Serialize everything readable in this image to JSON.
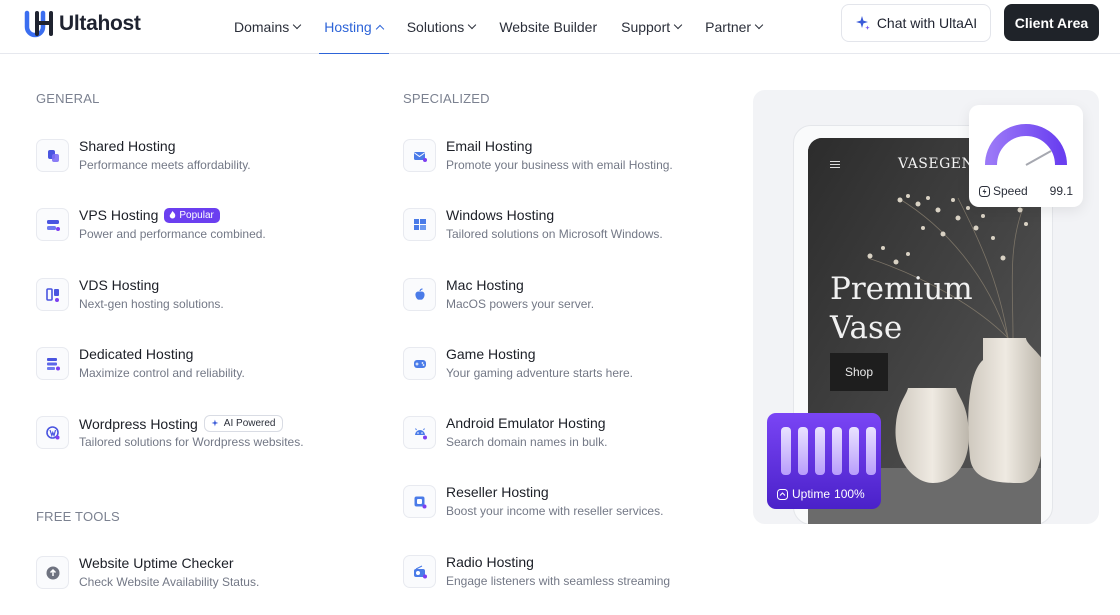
{
  "brand": {
    "logo_text": "Ultahost",
    "accent_color": "#2d64d8",
    "purple": "#6b3ff0"
  },
  "nav": {
    "items": [
      {
        "label": "Domains",
        "dropdown": true,
        "active": false
      },
      {
        "label": "Hosting",
        "dropdown": true,
        "active": true
      },
      {
        "label": "Solutions",
        "dropdown": true,
        "active": false
      },
      {
        "label": "Website Builder",
        "dropdown": false,
        "active": false
      },
      {
        "label": "Support",
        "dropdown": true,
        "active": false
      },
      {
        "label": "Partner",
        "dropdown": true,
        "active": false
      }
    ],
    "chat_label": "Chat with UltaAI",
    "client_area_label": "Client Area"
  },
  "general": {
    "title": "GENERAL",
    "items": [
      {
        "title": "Shared Hosting",
        "desc": "Performance meets affordability.",
        "icon": "shared-hosting-icon"
      },
      {
        "title": "VPS Hosting",
        "desc": "Power and performance combined.",
        "badge": "Popular",
        "icon": "vps-hosting-icon"
      },
      {
        "title": "VDS Hosting",
        "desc": "Next-gen hosting solutions.",
        "icon": "vds-hosting-icon"
      },
      {
        "title": "Dedicated Hosting",
        "desc": "Maximize control and reliability.",
        "icon": "dedicated-hosting-icon"
      },
      {
        "title": "Wordpress Hosting",
        "desc": "Tailored solutions for Wordpress websites.",
        "badge": "AI Powered",
        "icon": "wordpress-icon"
      }
    ]
  },
  "free_tools": {
    "title": "FREE TOOLS",
    "items": [
      {
        "title": "Website Uptime Checker",
        "desc": "Check Website Availability Status.",
        "icon": "uptime-checker-icon"
      }
    ]
  },
  "specialized": {
    "title": "SPECIALIZED",
    "items": [
      {
        "title": "Email Hosting",
        "desc": "Promote your business with email Hosting.",
        "icon": "email-icon"
      },
      {
        "title": "Windows Hosting",
        "desc": "Tailored solutions on Microsoft Windows.",
        "icon": "windows-icon"
      },
      {
        "title": "Mac Hosting",
        "desc": "MacOS powers your server.",
        "icon": "apple-icon"
      },
      {
        "title": "Game Hosting",
        "desc": "Your gaming adventure starts here.",
        "icon": "gamepad-icon"
      },
      {
        "title": "Android Emulator Hosting",
        "desc": "Search domain names in bulk.",
        "icon": "android-icon"
      },
      {
        "title": "Reseller Hosting",
        "desc": "Boost your income with reseller services.",
        "icon": "reseller-icon"
      },
      {
        "title": "Radio Hosting",
        "desc": "Engage listeners with seamless streaming",
        "icon": "radio-icon"
      }
    ]
  },
  "promo": {
    "store_brand": "VASEGEN",
    "headline_line1": "Premium",
    "headline_line2": "Vase",
    "shop_label": "Shop",
    "speed_label": "Speed",
    "speed_value": "99.1",
    "uptime_label": "Uptime",
    "uptime_value": "100%"
  }
}
